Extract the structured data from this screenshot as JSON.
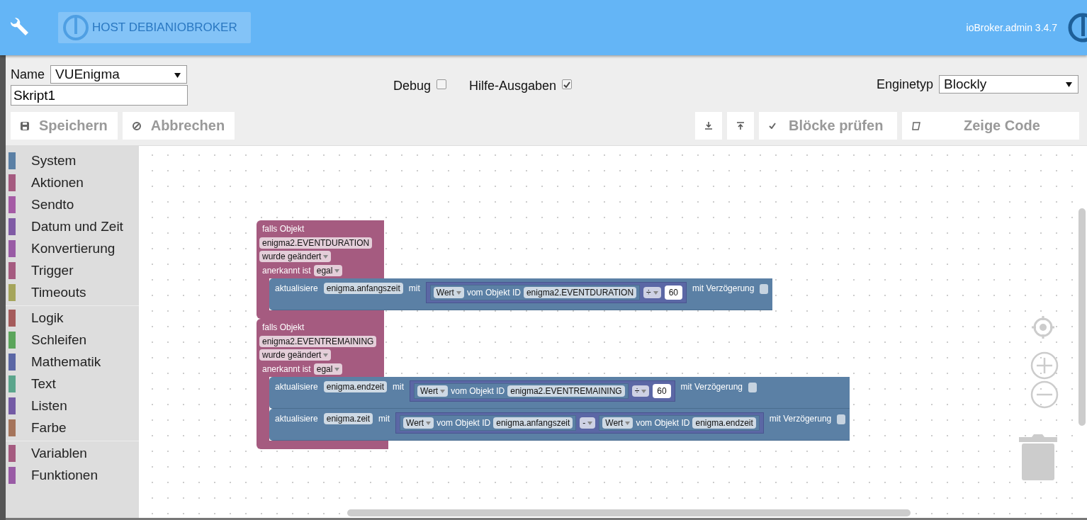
{
  "header": {
    "host": "HOST DEBIANIOBROKER",
    "version": "ioBroker.admin 3.4.7"
  },
  "script": {
    "name_label": "Name",
    "name": "VUEnigma",
    "group": "Skript1",
    "debug_label": "Debug",
    "debug": false,
    "help_label": "Hilfe-Ausgaben",
    "help": true,
    "engine_label": "Enginetyp",
    "engine": "Blockly"
  },
  "toolbar": {
    "left": [
      {
        "label": "Speichern"
      },
      {
        "label": "Abbrechen"
      }
    ],
    "right": [
      {
        "kind": "icon"
      },
      {
        "kind": "icon"
      },
      {
        "kind": "text",
        "label": "Blöcke prüfen"
      },
      {
        "kind": "text",
        "label": "Zeige Code"
      }
    ]
  },
  "categories": [
    [
      {
        "label": "System",
        "color": "#5b80a5"
      },
      {
        "label": "Aktionen",
        "color": "#a55b80"
      },
      {
        "label": "Sendto",
        "color": "#a55ba5"
      },
      {
        "label": "Datum und Zeit",
        "color": "#805ba5"
      },
      {
        "label": "Konvertierung",
        "color": "#995ba5"
      },
      {
        "label": "Trigger",
        "color": "#a55b80"
      },
      {
        "label": "Timeouts",
        "color": "#a5a55b"
      }
    ],
    [
      {
        "label": "Logik",
        "color": "#a55b5b"
      },
      {
        "label": "Schleifen",
        "color": "#5ba55b"
      },
      {
        "label": "Mathematik",
        "color": "#5b67a5"
      },
      {
        "label": "Text",
        "color": "#5ba58c"
      },
      {
        "label": "Listen",
        "color": "#745ba5"
      },
      {
        "label": "Farbe",
        "color": "#a5745b"
      }
    ],
    [
      {
        "label": "Variablen",
        "color": "#a55b80"
      },
      {
        "label": "Funktionen",
        "color": "#995ba5"
      }
    ]
  ],
  "blocks": [
    {
      "title": "falls Objekt",
      "object": "enigma2.EVENTDURATION",
      "event": "wurde geändert",
      "ack_label": "anerkannt ist",
      "ack": "egal",
      "actions": [
        {
          "label": "aktualisiere",
          "target": "enigma.anfangszeit",
          "with": "mit",
          "delay_label": "mit Verzögerung",
          "delay": false,
          "value": {
            "kind": "arith",
            "op": "÷",
            "left": {
              "kind": "get",
              "attr": "Wert",
              "label": "vom Objekt ID",
              "id": "enigma2.EVENTDURATION"
            },
            "right": {
              "kind": "number",
              "value": "60"
            }
          }
        }
      ]
    },
    {
      "title": "falls Objekt",
      "object": "enigma2.EVENTREMAINING",
      "event": "wurde geändert",
      "ack_label": "anerkannt ist",
      "ack": "egal",
      "actions": [
        {
          "label": "aktualisiere",
          "target": "enigma.endzeit",
          "with": "mit",
          "delay_label": "mit Verzögerung",
          "delay": false,
          "value": {
            "kind": "arith",
            "op": "÷",
            "left": {
              "kind": "get",
              "attr": "Wert",
              "label": "vom Objekt ID",
              "id": "enigma2.EVENTREMAINING"
            },
            "right": {
              "kind": "number",
              "value": "60"
            }
          }
        },
        {
          "label": "aktualisiere",
          "target": "enigma.zeit",
          "with": "mit",
          "delay_label": "mit Verzögerung",
          "delay": false,
          "value": {
            "kind": "arith",
            "op": "-",
            "left": {
              "kind": "get",
              "attr": "Wert",
              "label": "vom Objekt ID",
              "id": "enigma.anfangszeit"
            },
            "right": {
              "kind": "get",
              "attr": "Wert",
              "label": "vom Objekt ID",
              "id": "enigma.endzeit"
            }
          }
        }
      ]
    }
  ]
}
